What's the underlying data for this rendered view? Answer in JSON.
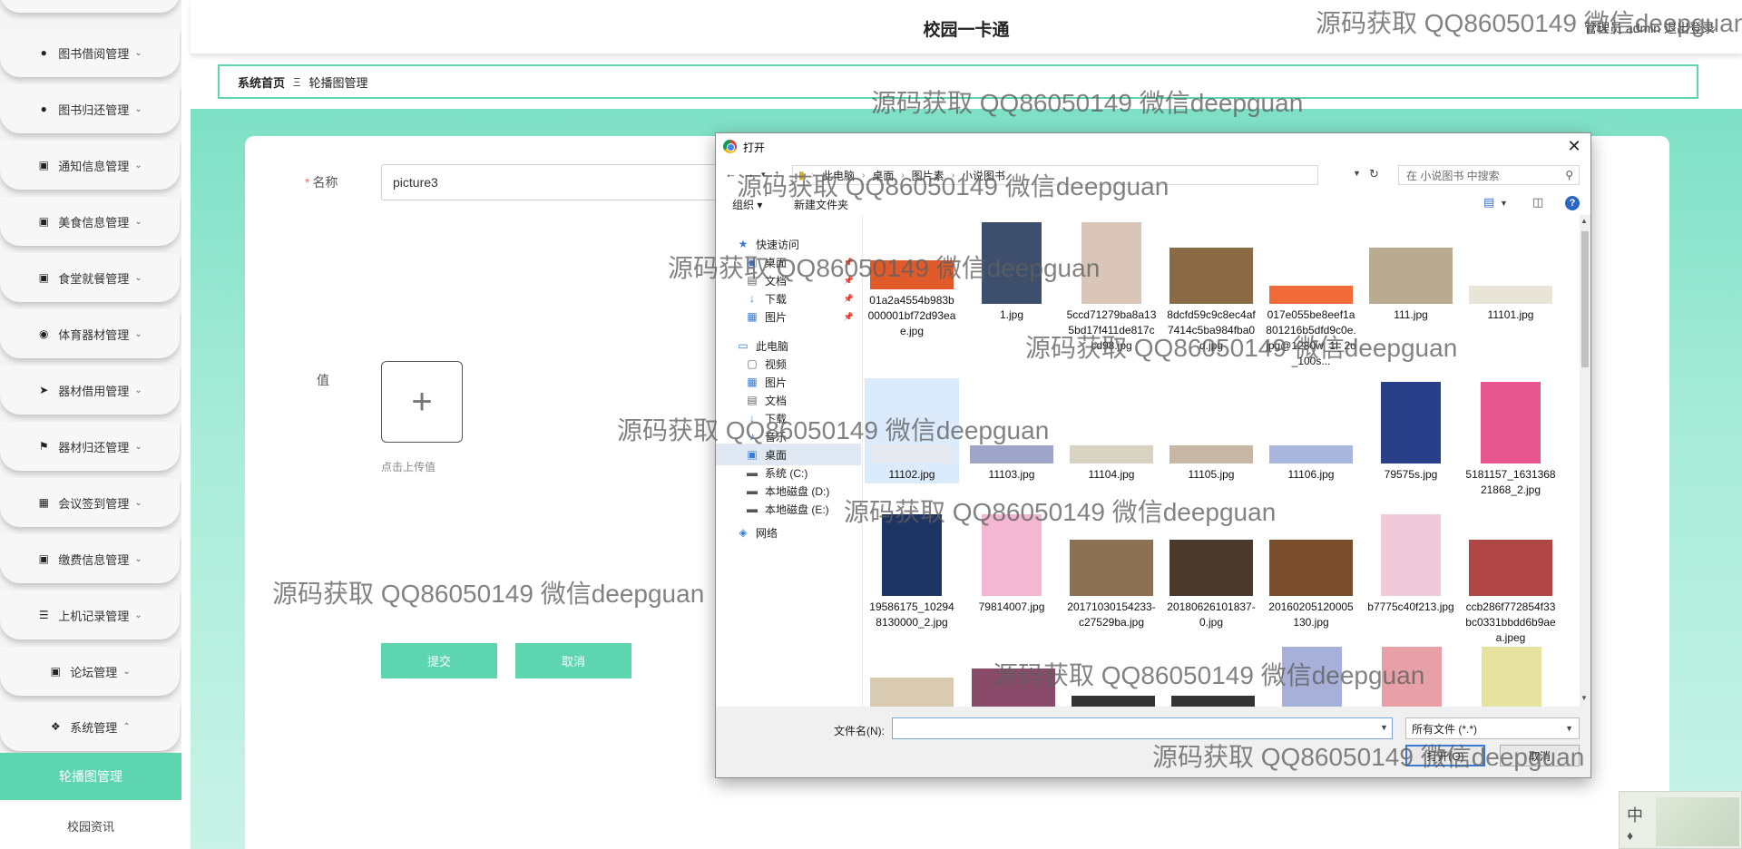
{
  "app": {
    "title": "校园一卡通",
    "user_info": "管理员 admin 退出登录"
  },
  "sidebar": {
    "items": [
      {
        "label": "图书借阅管理",
        "icon": "person-icon"
      },
      {
        "label": "图书归还管理",
        "icon": "person-icon"
      },
      {
        "label": "通知信息管理",
        "icon": "grid-icon"
      },
      {
        "label": "美食信息管理",
        "icon": "grid-icon"
      },
      {
        "label": "食堂就餐管理",
        "icon": "grid-icon"
      },
      {
        "label": "体育器材管理",
        "icon": "bulb-icon"
      },
      {
        "label": "器材借用管理",
        "icon": "send-icon"
      },
      {
        "label": "器材归还管理",
        "icon": "flag-icon"
      },
      {
        "label": "会议签到管理",
        "icon": "apps-icon"
      },
      {
        "label": "缴费信息管理",
        "icon": "grid-icon"
      },
      {
        "label": "上机记录管理",
        "icon": "list-icon"
      },
      {
        "label": "论坛管理",
        "icon": "grid-icon"
      },
      {
        "label": "系统管理",
        "icon": "butterfly-icon"
      }
    ],
    "active": "轮播图管理",
    "sub": "校园资讯"
  },
  "breadcrumb": {
    "home": "系统首页",
    "separator": "Ξ",
    "current": "轮播图管理"
  },
  "form": {
    "name_label": "名称",
    "name_value": "picture3",
    "value_label": "值",
    "upload_hint": "点击上传值",
    "submit": "提交",
    "cancel": "取消"
  },
  "dialog": {
    "title": "打开",
    "address": [
      "此电脑",
      "桌面",
      "图片素",
      "小说图书"
    ],
    "search_placeholder": "在 小说图书 中搜索",
    "toolbar": {
      "organize": "组织 ▾",
      "new_folder": "新建文件夹"
    },
    "nav": [
      {
        "label": "快速访问",
        "icon": "star-icon"
      },
      {
        "label": "桌面",
        "icon": "desktop-icon",
        "pinned": true
      },
      {
        "label": "文档",
        "icon": "document-icon",
        "pinned": true
      },
      {
        "label": "下载",
        "icon": "download-icon",
        "pinned": true
      },
      {
        "label": "图片",
        "icon": "picture-icon",
        "pinned": true
      },
      {
        "label": "此电脑",
        "icon": "computer-icon"
      },
      {
        "label": "视频",
        "icon": "video-icon"
      },
      {
        "label": "图片",
        "icon": "picture-icon"
      },
      {
        "label": "文档",
        "icon": "document-icon"
      },
      {
        "label": "下载",
        "icon": "download-icon"
      },
      {
        "label": "音乐",
        "icon": "music-icon"
      },
      {
        "label": "桌面",
        "icon": "desktop-icon",
        "selected": true
      },
      {
        "label": "系统 (C:)",
        "icon": "drive-icon"
      },
      {
        "label": "本地磁盘 (D:)",
        "icon": "drive-icon"
      },
      {
        "label": "本地磁盘 (E:)",
        "icon": "drive-icon"
      },
      {
        "label": "网络",
        "icon": "network-icon"
      }
    ],
    "files": [
      {
        "name": "01a2a4554b983b000001bf72d93eae.jpg",
        "color": "#e05a2a",
        "shape": "mid"
      },
      {
        "name": "1.jpg",
        "color": "#3e4f6e",
        "shape": "tall"
      },
      {
        "name": "5ccd71279ba8a135bd17f411de817ccd98.jpg",
        "color": "#d9c6b8",
        "shape": "tall"
      },
      {
        "name": "8dcfd59c9c8ec4af7414c5ba984fba0d.jpg",
        "color": "#8a6a45",
        "shape": "wide"
      },
      {
        "name": "017e055be8eef1a801216b5dfd9c0e.jpg@1280w_1l_2o_100s...",
        "color": "#f06a3a",
        "shape": "strip"
      },
      {
        "name": "111.jpg",
        "color": "#b9ab8f",
        "shape": "wide"
      },
      {
        "name": "11101.jpg",
        "color": "#e8e4d8",
        "shape": "strip"
      },
      {
        "name": "11102.jpg",
        "color": "#e6e9ef",
        "shape": "strip",
        "selected": true
      },
      {
        "name": "11103.jpg",
        "color": "#9ea5c9",
        "shape": "strip"
      },
      {
        "name": "11104.jpg",
        "color": "#d7d2c1",
        "shape": "strip"
      },
      {
        "name": "11105.jpg",
        "color": "#c9b7a6",
        "shape": "strip"
      },
      {
        "name": "11106.jpg",
        "color": "#a9b6dd",
        "shape": "strip"
      },
      {
        "name": "79575s.jpg",
        "color": "#2a3f8a",
        "shape": "tall"
      },
      {
        "name": "5181157_163136821868_2.jpg",
        "color": "#e8568f",
        "shape": "tall"
      },
      {
        "name": "19586175_102948130000_2.jpg",
        "color": "#1e3564",
        "shape": "tall"
      },
      {
        "name": "79814007.jpg",
        "color": "#f3b7d1",
        "shape": "tall"
      },
      {
        "name": "20171030154233-c27529ba.jpg",
        "color": "#8b7151",
        "shape": "wide"
      },
      {
        "name": "20180626101837-0.jpg",
        "color": "#4a3a2e",
        "shape": "wide"
      },
      {
        "name": "20160205120005130.jpg",
        "color": "#7a4e2c",
        "shape": "wide"
      },
      {
        "name": "b7775c40f213.jpg",
        "color": "#f0cad9",
        "shape": "tall"
      },
      {
        "name": "ccb286f772854f33bc0331bbdd6b9aea.jpeg",
        "color": "#b04545",
        "shape": "wide"
      }
    ],
    "filename_label": "文件名(N):",
    "filter": "所有文件 (*.*)",
    "open": "打开(O)",
    "cancel": "取消"
  },
  "watermark": "源码获取 QQ86050149 微信deepguan",
  "ime": {
    "label": "中"
  }
}
